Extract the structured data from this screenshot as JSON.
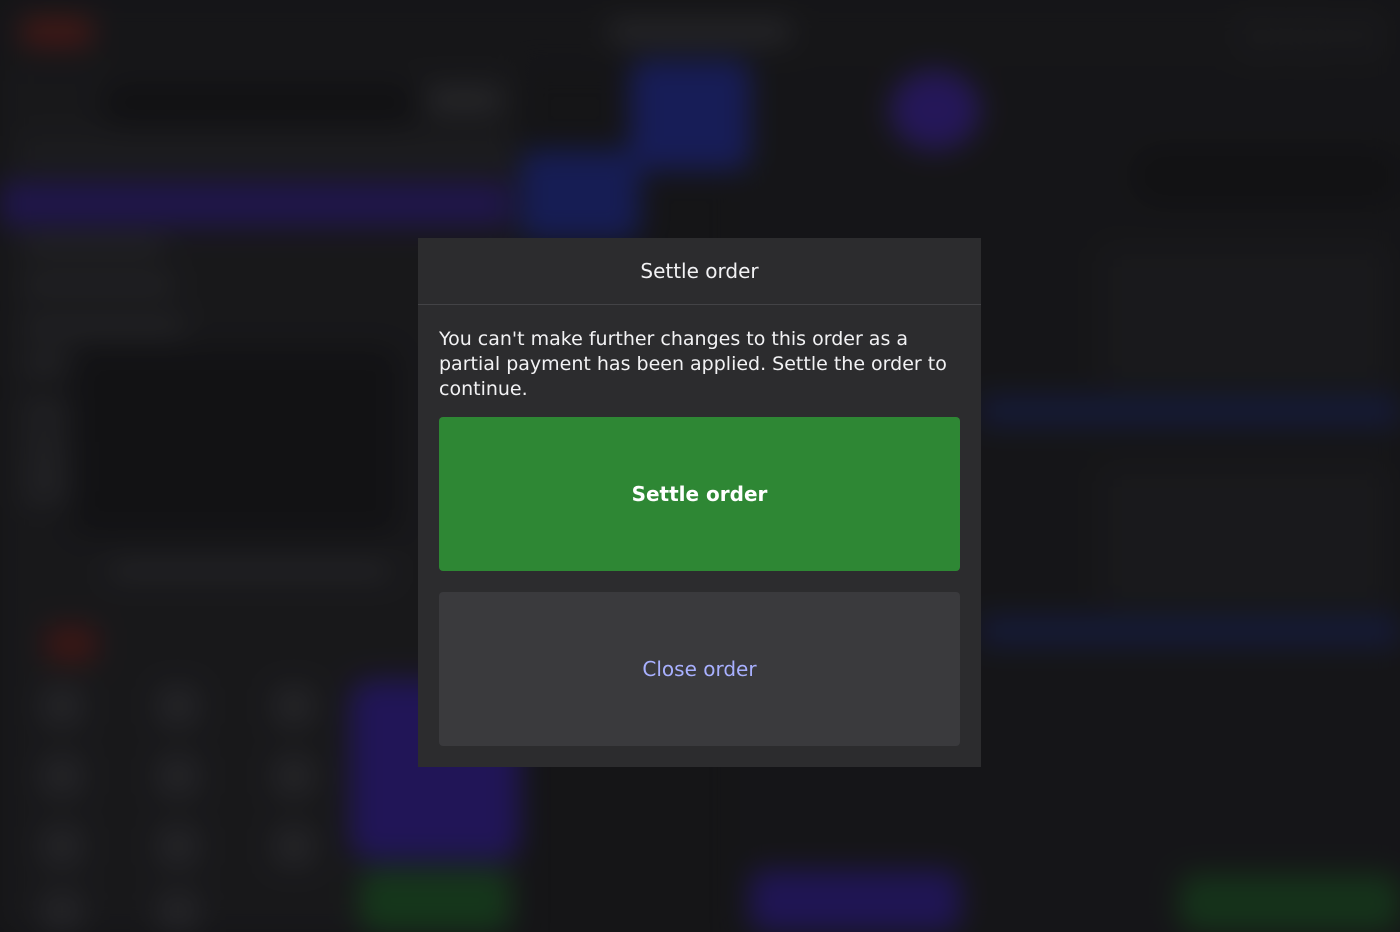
{
  "modal": {
    "title": "Settle order",
    "message": "You can't make further changes to this order as a partial payment has been applied. Settle the order to continue.",
    "settle_label": "Settle order",
    "close_label": "Close order"
  },
  "colors": {
    "settle_button": "#2e8734",
    "close_button_text": "#a8b0ff",
    "modal_background": "#2c2c2e"
  }
}
